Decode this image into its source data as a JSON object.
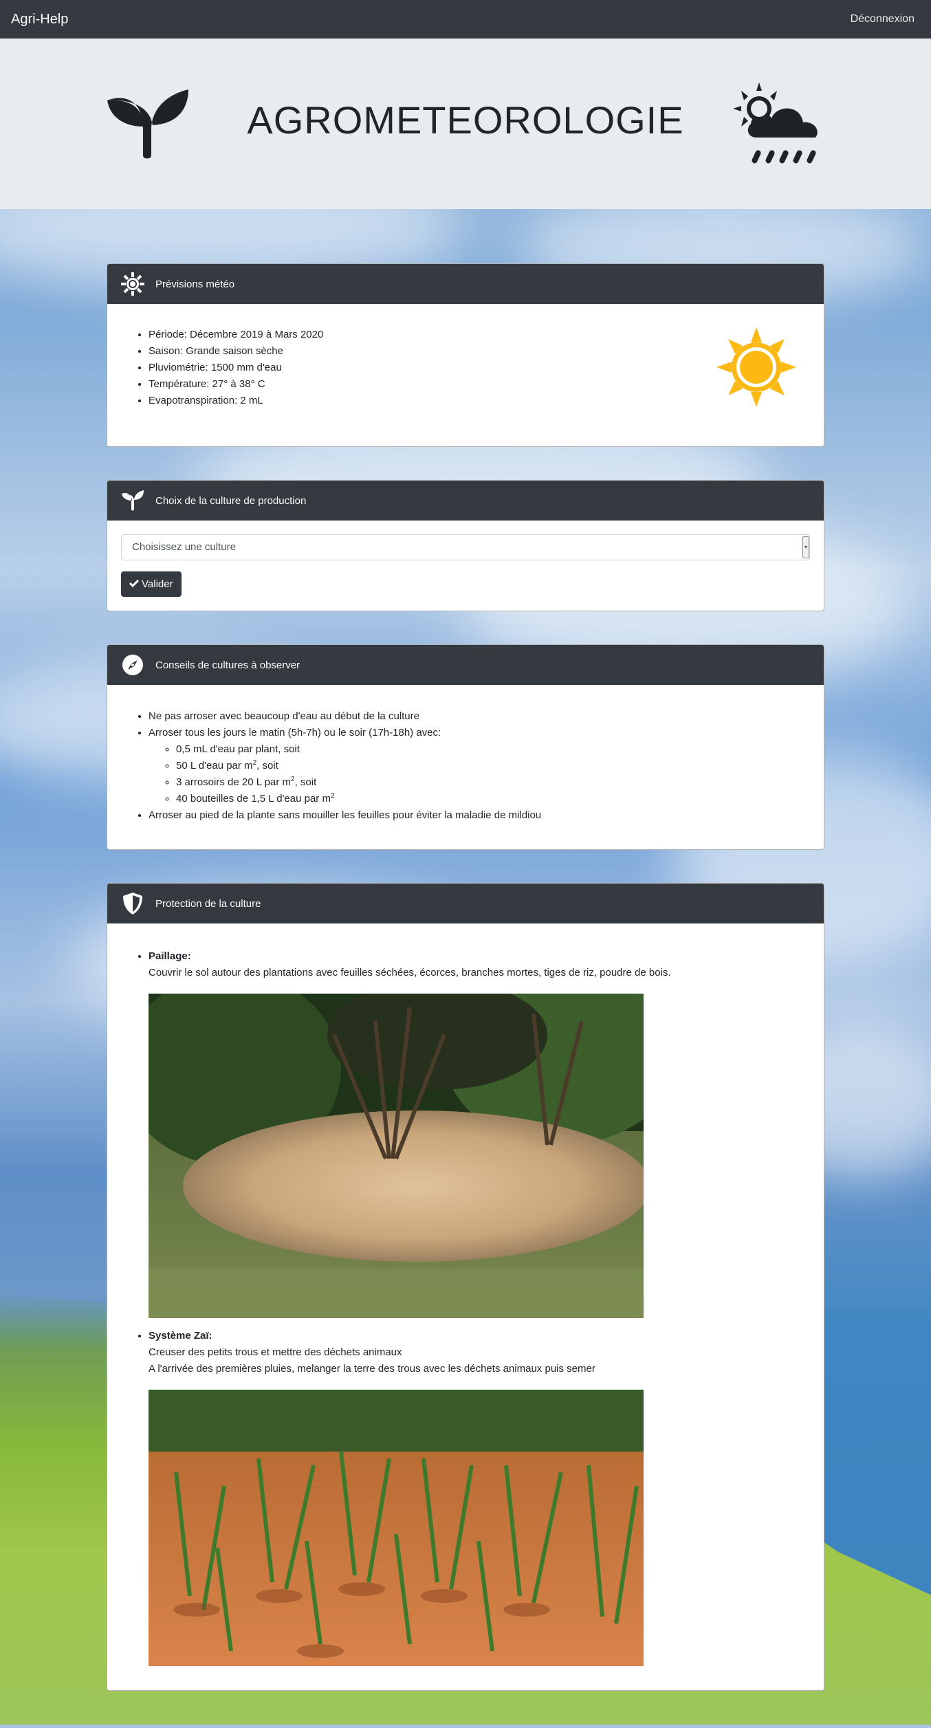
{
  "navbar": {
    "brand": "Agri-Help",
    "logout": "Déconnexion"
  },
  "hero": {
    "title": "AGROMETEOROLOGIE",
    "left_icon": "sprout-icon",
    "right_icon": "sun-cloud-rain-icon"
  },
  "weather": {
    "title": "Prévisions météo",
    "icon": "sun-icon",
    "items": [
      "Période: Décembre 2019 à Mars 2020",
      "Saison: Grande saison sèche",
      "Pluviométrie: 1500 mm d'eau",
      "Température: 27° à 38° C",
      "Evapotranspiration: 2 mL"
    ]
  },
  "crop_choice": {
    "title": "Choix de la culture de production",
    "select_value": "Choisissez une culture",
    "button_label": "Valider"
  },
  "advice": {
    "title": "Conseils de cultures à observer",
    "item1": "Ne pas arroser avec beaucoup d'eau au début de la culture",
    "item2": "Arroser tous les jours le matin (5h-7h) ou le soir (17h-18h) avec:",
    "sub1": "0,5 mL d'eau par plant, soit",
    "sub2_a": "50 L d'eau par m",
    "sub2_b": ", soit",
    "sub3_a": "3 arrosoirs de 20 L par m",
    "sub3_b": ", soit",
    "sub4_a": "40 bouteilles de 1,5 L d'eau par m",
    "sup": "2",
    "item3": "Arroser au pied de la plante sans mouiller les feuilles pour éviter la maladie de mildiou"
  },
  "protection": {
    "title": "Protection de la culture",
    "paillage_title": "Paillage:",
    "paillage_text": "Couvrir le sol autour des plantations avec feuilles séchées, écorces, branches mortes, tiges de riz, poudre de bois.",
    "zai_title": "Système Zaï:",
    "zai_text1": "Creuser des petits trous et mettre des déchets animaux",
    "zai_text2": "A l'arrivée des premières pluies, melanger la terre des trous avec les déchets animaux puis semer"
  },
  "colors": {
    "navbar": "#343a40",
    "hero_bg": "#e9ecef",
    "sun": "#fcb914"
  }
}
